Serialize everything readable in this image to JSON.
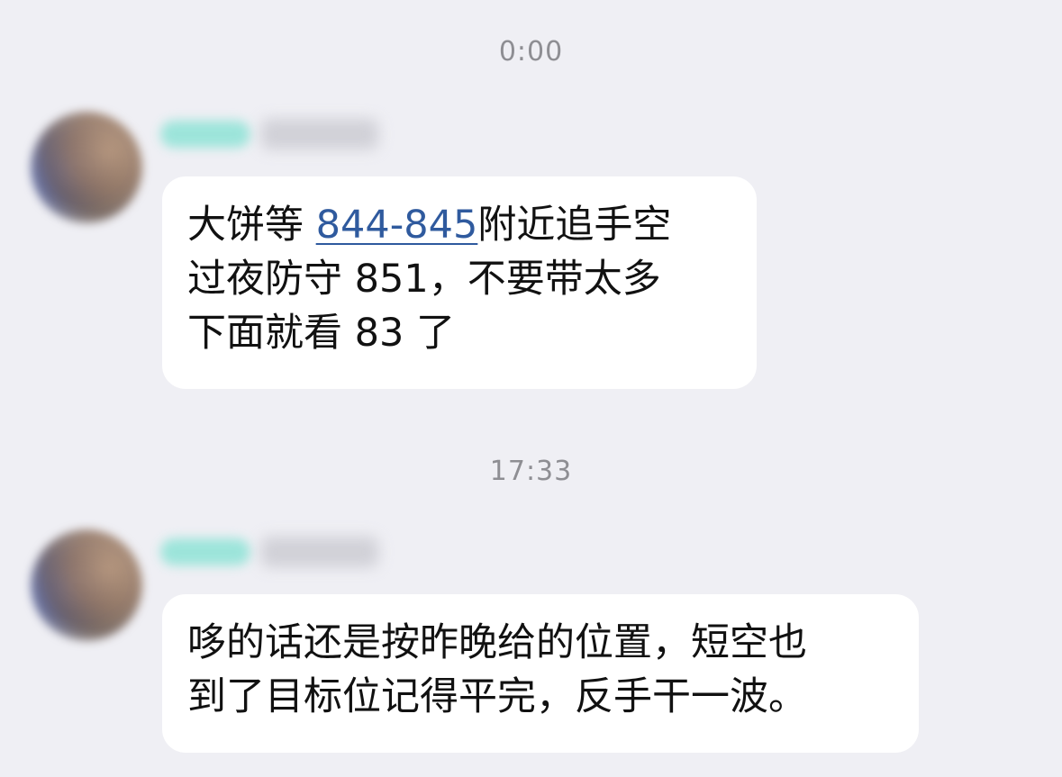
{
  "messages": [
    {
      "timestamp": "0:00",
      "sender": {
        "avatar": "avatar",
        "name": "",
        "badge": ""
      },
      "lines": [
        {
          "before": "大饼等 ",
          "link": "844-845",
          "after": "附近追手空"
        },
        {
          "text": "过夜防守 851，不要带太多"
        },
        {
          "text": "下面就看 83 了"
        }
      ]
    },
    {
      "timestamp": "17:33",
      "sender": {
        "avatar": "avatar",
        "name": "",
        "badge": ""
      },
      "lines": [
        {
          "text": "哆的话还是按昨晚给的位置，短空也"
        },
        {
          "text": "到了目标位记得平完，反手干一波。"
        }
      ]
    }
  ],
  "colors": {
    "background": "#efeff4",
    "bubble": "#ffffff",
    "link": "#2f5a9e",
    "timestamp": "#8e8e93"
  }
}
